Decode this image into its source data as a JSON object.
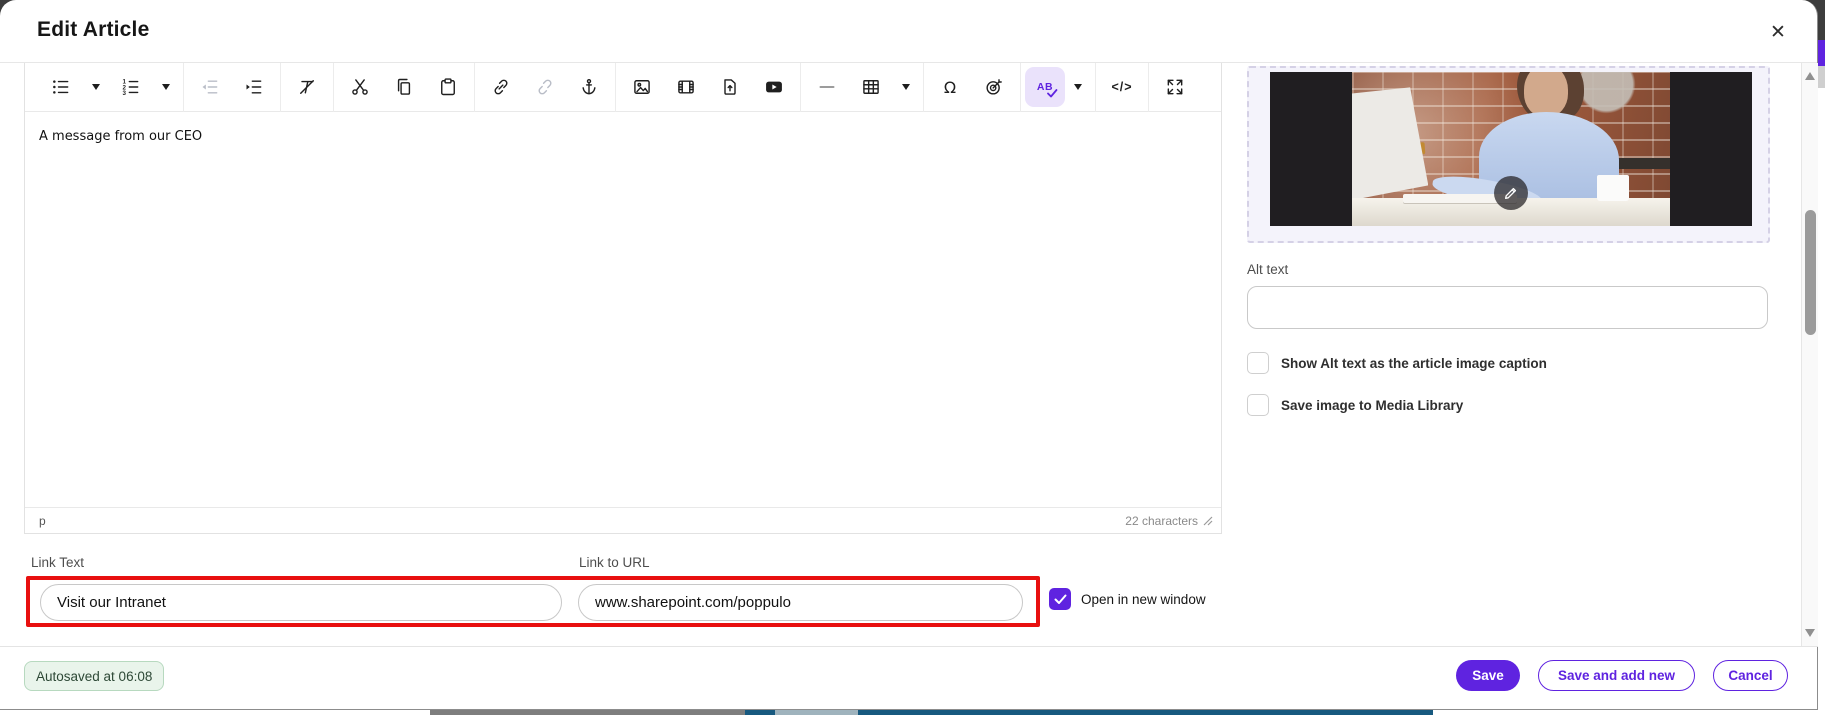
{
  "header": {
    "title": "Edit Article"
  },
  "toolbar": {
    "groups": [
      [
        {
          "icon": "bullet-list",
          "caret": true
        },
        {
          "icon": "numbered-list",
          "caret": true
        }
      ],
      [
        {
          "icon": "outdent",
          "disabled": true
        },
        {
          "icon": "indent"
        }
      ],
      [
        {
          "icon": "clear-formatting"
        }
      ],
      [
        {
          "icon": "cut"
        },
        {
          "icon": "copy"
        },
        {
          "icon": "paste"
        }
      ],
      [
        {
          "icon": "insert-link"
        },
        {
          "icon": "unlink",
          "disabled": true
        },
        {
          "icon": "anchor"
        }
      ],
      [
        {
          "icon": "insert-image"
        },
        {
          "icon": "insert-video"
        },
        {
          "icon": "insert-file"
        },
        {
          "icon": "youtube"
        }
      ],
      [
        {
          "icon": "horizontal-line",
          "muted": true
        },
        {
          "icon": "insert-table",
          "caret": true
        }
      ],
      [
        {
          "icon": "special-characters"
        },
        {
          "icon": "personalization-target"
        }
      ],
      [
        {
          "icon": "spellcheck-ab",
          "active": true,
          "caret": true
        }
      ],
      [
        {
          "icon": "code-view"
        }
      ],
      [
        {
          "icon": "fullscreen"
        }
      ]
    ]
  },
  "editor": {
    "content": "A message from our CEO",
    "status_block": "p",
    "char_count": "22 characters"
  },
  "link_section": {
    "link_text_label": "Link Text",
    "link_text_value": "Visit our Intranet",
    "link_url_label": "Link to URL",
    "link_url_value": "www.sharepoint.com/poppulo",
    "open_new_window_label": "Open in new window",
    "open_new_window_checked": true
  },
  "right_panel": {
    "alt_text_label": "Alt text",
    "alt_text_value": "",
    "checkboxes": [
      {
        "label": "Show Alt text as the article image caption",
        "checked": false
      },
      {
        "label": "Save image to Media Library",
        "checked": false
      }
    ]
  },
  "footer": {
    "autosaved": "Autosaved at 06:08",
    "buttons": [
      {
        "label": "Save",
        "style": "primary"
      },
      {
        "label": "Save and add new",
        "style": "outline"
      },
      {
        "label": "Cancel",
        "style": "outline"
      }
    ]
  },
  "colors": {
    "accent": "#5f23e0",
    "highlight_red": "#e8100f",
    "autosave_bg": "#e9f4eb",
    "autosave_border": "#b7d9bf"
  }
}
